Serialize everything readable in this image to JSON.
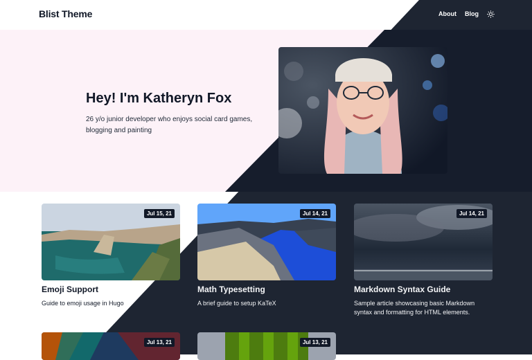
{
  "site": {
    "brand": "Blist Theme",
    "nav": [
      {
        "label": "About"
      },
      {
        "label": "Blog"
      }
    ]
  },
  "hero": {
    "title": "Hey! I'm Katheryn Fox",
    "subtitle_line1": "26 y/o junior developer who enjoys social card games,",
    "subtitle_line2": "blogging and painting"
  },
  "posts": [
    {
      "date": "Jul 15, 21",
      "title": "Emoji Support",
      "desc_line1": "Guide to emoji usage in Hugo",
      "desc_line2": ""
    },
    {
      "date": "Jul 14, 21",
      "title": "Math Typesetting",
      "desc_line1": "A brief guide to setup KaTeX",
      "desc_line2": ""
    },
    {
      "date": "Jul 14, 21",
      "title": "Markdown Syntax Guide",
      "desc_line1": "Sample article showcasing basic Markdown",
      "desc_line2": "syntax and formatting for HTML elements."
    },
    {
      "date": "Jul 13, 21"
    },
    {
      "date": "Jul 13, 21"
    }
  ],
  "colors": {
    "hero_background": "#fdf2f8",
    "dark_background": "#1f2937",
    "dark_navy": "#151c2b",
    "text": "#111827"
  },
  "icons": [
    "sun-icon"
  ]
}
